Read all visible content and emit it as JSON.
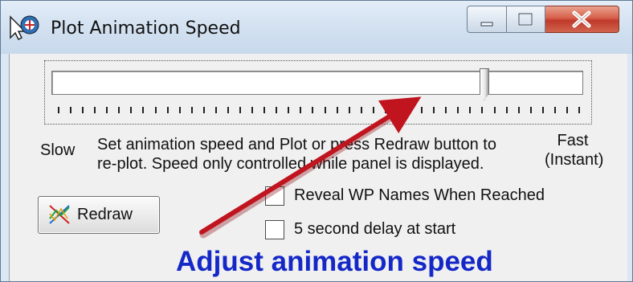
{
  "window": {
    "title": "Plot Animation Speed",
    "minimize_glyph": "—",
    "maximize_glyph": "□",
    "close_glyph": "X",
    "icon": "app-plot-icon"
  },
  "slider": {
    "speed_position": 0.82,
    "tick_count": 44,
    "slow_label": "Slow",
    "fast_label_line1": "Fast",
    "fast_label_line2": "(Instant)",
    "description_line1": "Set animation speed and Plot or press Redraw button to",
    "description_line2": "re-plot. Speed only controlled while panel is displayed."
  },
  "redraw_button": {
    "label": "Redraw",
    "icon": "redraw-icon"
  },
  "options": [
    {
      "label": "Reveal WP Names When Reached",
      "checked": false
    },
    {
      "label": "5 second delay at start",
      "checked": false
    }
  ],
  "annotation": {
    "text": "Adjust animation speed",
    "color": "#1428c8",
    "arrow_color": "#c0141e"
  }
}
